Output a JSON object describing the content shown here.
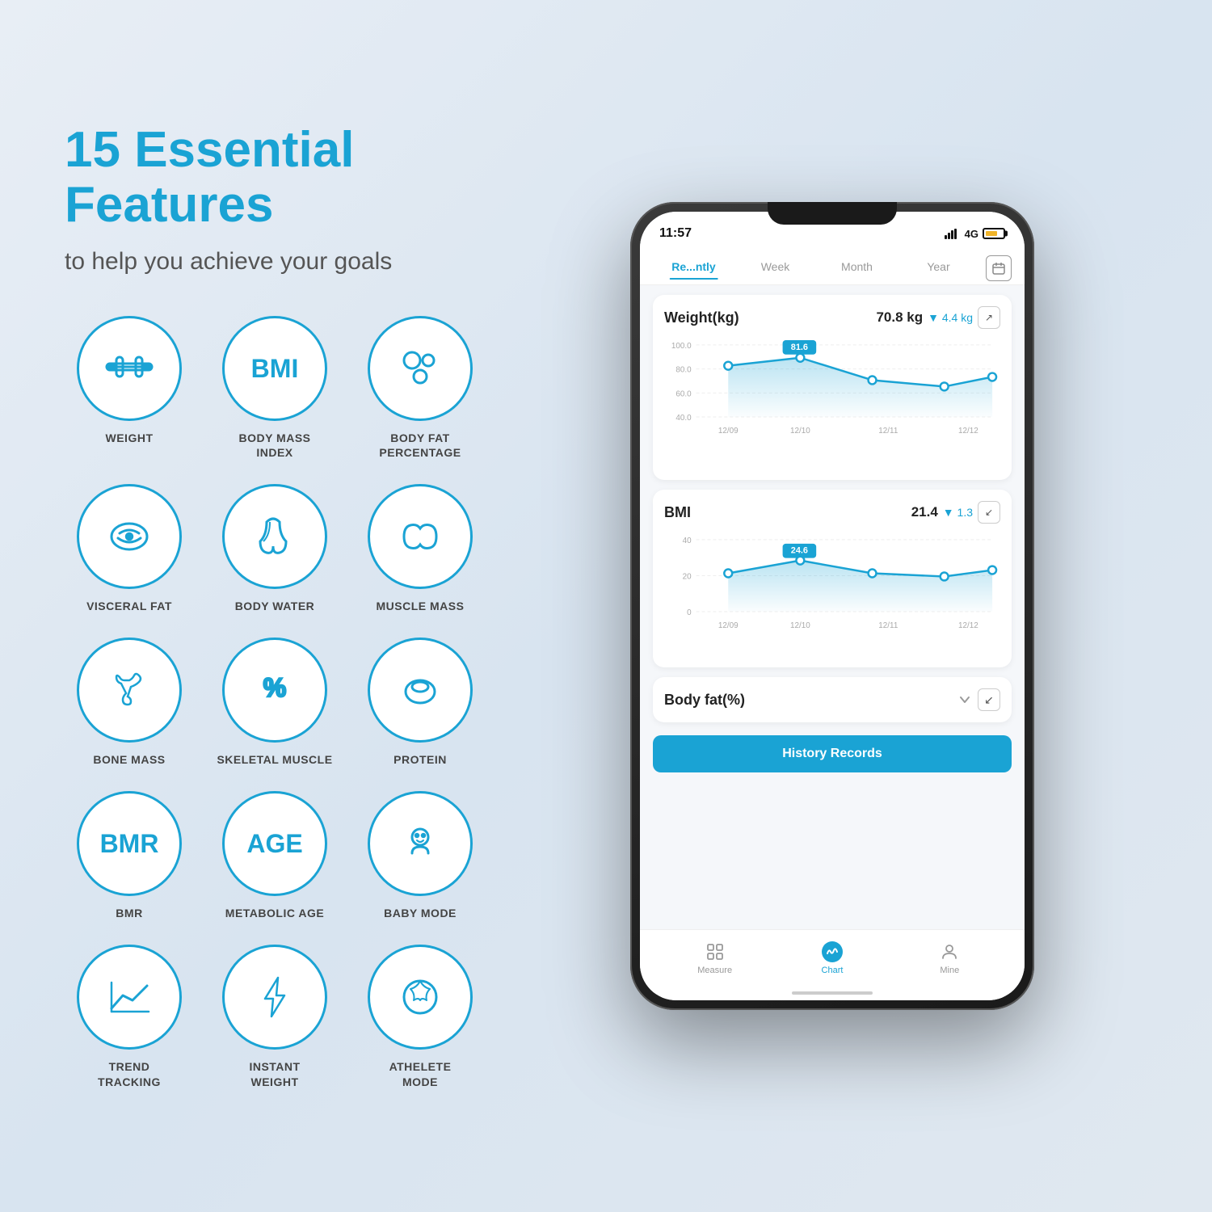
{
  "page": {
    "title": "15 Essential Features",
    "subtitle": "to help you achieve your goals"
  },
  "features": [
    {
      "id": "weight",
      "label": "WEIGHT",
      "icon": "barbell"
    },
    {
      "id": "bmi",
      "label": "BODY MASS\nINDEX",
      "icon": "BMI"
    },
    {
      "id": "bodyfat",
      "label": "BODY FAT\nPERCENTAGE",
      "icon": "circles"
    },
    {
      "id": "visceralfat",
      "label": "VISCERAL FAT",
      "icon": "tape"
    },
    {
      "id": "bodywater",
      "label": "BODY WATER",
      "icon": "drops"
    },
    {
      "id": "musclemass",
      "label": "MUSCLE MASS",
      "icon": "leaf"
    },
    {
      "id": "bonemass",
      "label": "BONE MASS",
      "icon": "bone"
    },
    {
      "id": "skeletal",
      "label": "SKELETAL MUSCLE",
      "icon": "percent"
    },
    {
      "id": "protein",
      "label": "PROTEIN",
      "icon": "egg"
    },
    {
      "id": "bmr",
      "label": "BMR",
      "icon": "BMR"
    },
    {
      "id": "metabolicage",
      "label": "METABOLIC AGE",
      "icon": "AGE"
    },
    {
      "id": "babymode",
      "label": "BABY MODE",
      "icon": "baby"
    },
    {
      "id": "trend",
      "label": "TREND\nTRACKING",
      "icon": "chart"
    },
    {
      "id": "instant",
      "label": "INSTANT\nWEIGHT",
      "icon": "bolt"
    },
    {
      "id": "athelete",
      "label": "ATHELETE\nMODE",
      "icon": "soccer"
    }
  ],
  "phone": {
    "statusBar": {
      "time": "11:57",
      "signal": "4G"
    },
    "tabs": [
      {
        "label": "Re...ntly",
        "active": true
      },
      {
        "label": "Week",
        "active": false
      },
      {
        "label": "Month",
        "active": false
      },
      {
        "label": "Year",
        "active": false
      }
    ],
    "weightCard": {
      "title": "Weight(kg)",
      "value": "70.8 kg",
      "diff": "4.4 kg",
      "peakLabel": "81.6",
      "yLabels": [
        "100.0",
        "80.0",
        "60.0",
        "40.0"
      ],
      "xLabels": [
        "12/09",
        "12/10",
        "12/11",
        "12/12"
      ]
    },
    "bmiCard": {
      "title": "BMI",
      "value": "21.4",
      "diff": "1.3",
      "peakLabel": "24.6",
      "yLabels": [
        "40",
        "20",
        "0"
      ],
      "xLabels": [
        "12/09",
        "12/10",
        "12/11",
        "12/12"
      ]
    },
    "bodyFatCard": {
      "title": "Body fat(%)"
    },
    "historyBtn": "History Records",
    "bottomNav": [
      {
        "label": "Measure",
        "active": false,
        "icon": "grid"
      },
      {
        "label": "Chart",
        "active": true,
        "icon": "chart-line"
      },
      {
        "label": "Mine",
        "active": false,
        "icon": "person"
      }
    ]
  }
}
